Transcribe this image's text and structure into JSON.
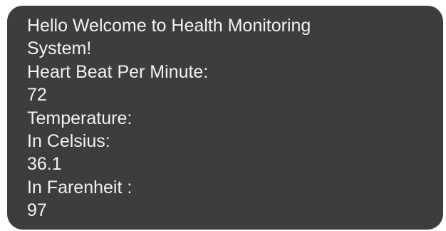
{
  "panel": {
    "greeting_line1": "Hello Welcome to Health Monitoring",
    "greeting_line2": "System!",
    "heart_label": "Heart Beat Per Minute:",
    "heart_value": "72",
    "temperature_label": "Temperature:",
    "celsius_label": "In Celsius:",
    "celsius_value": "36.1",
    "fahrenheit_label": "In Farenheit :",
    "fahrenheit_value": "97"
  },
  "colors": {
    "background": "#3d3d3d",
    "text": "#f2f2f2"
  }
}
